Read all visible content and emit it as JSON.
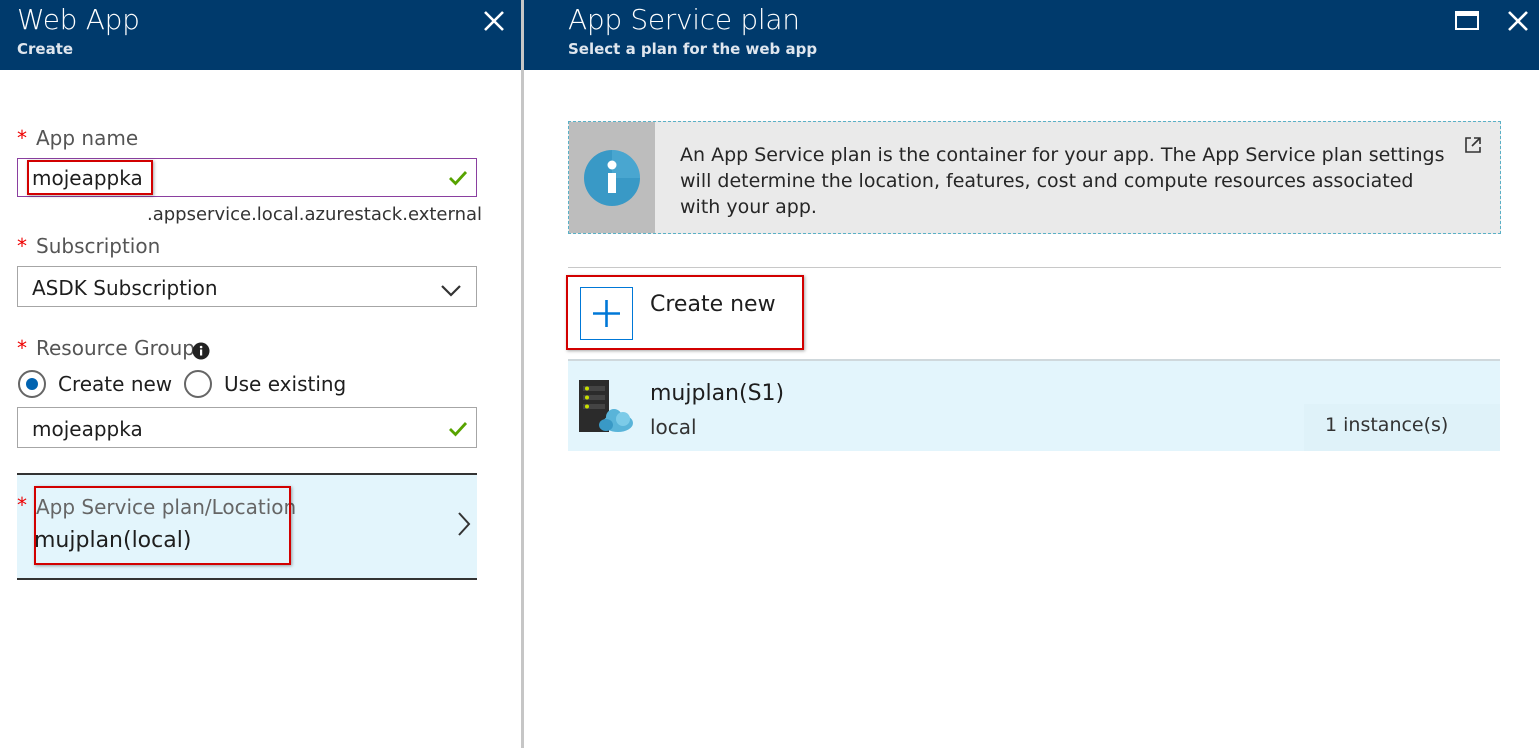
{
  "left_blade": {
    "title": "Web App",
    "subtitle": "Create",
    "close_icon": "close-icon",
    "app_name": {
      "label": "App name",
      "value": "mojeappka",
      "suffix": ".appservice.local.azurestack.external"
    },
    "subscription": {
      "label": "Subscription",
      "value": "ASDK Subscription"
    },
    "resource_group": {
      "label": "Resource Group",
      "option_create": "Create new",
      "option_existing": "Use existing",
      "selected": "Create new",
      "value": "mojeappka"
    },
    "plan_location": {
      "label": "App Service plan/Location",
      "value": "mujplan(local)"
    }
  },
  "right_blade": {
    "title": "App Service plan",
    "subtitle": "Select a plan for the web app",
    "info_text": "An App Service plan is the container for your app. The App Service plan settings will determine the location, features, cost and compute resources associated with your app.",
    "create_new_label": "Create new",
    "plans": [
      {
        "name": "mujplan(S1)",
        "location": "local",
        "instances": "1 instance(s)"
      }
    ]
  },
  "colors": {
    "header_bg": "#003a6c",
    "accent_blue": "#0078d7",
    "required_star": "#e00000",
    "highlight_box": "#d20000",
    "valid_check": "#57a300",
    "selected_row_bg": "#e3f5fc"
  }
}
